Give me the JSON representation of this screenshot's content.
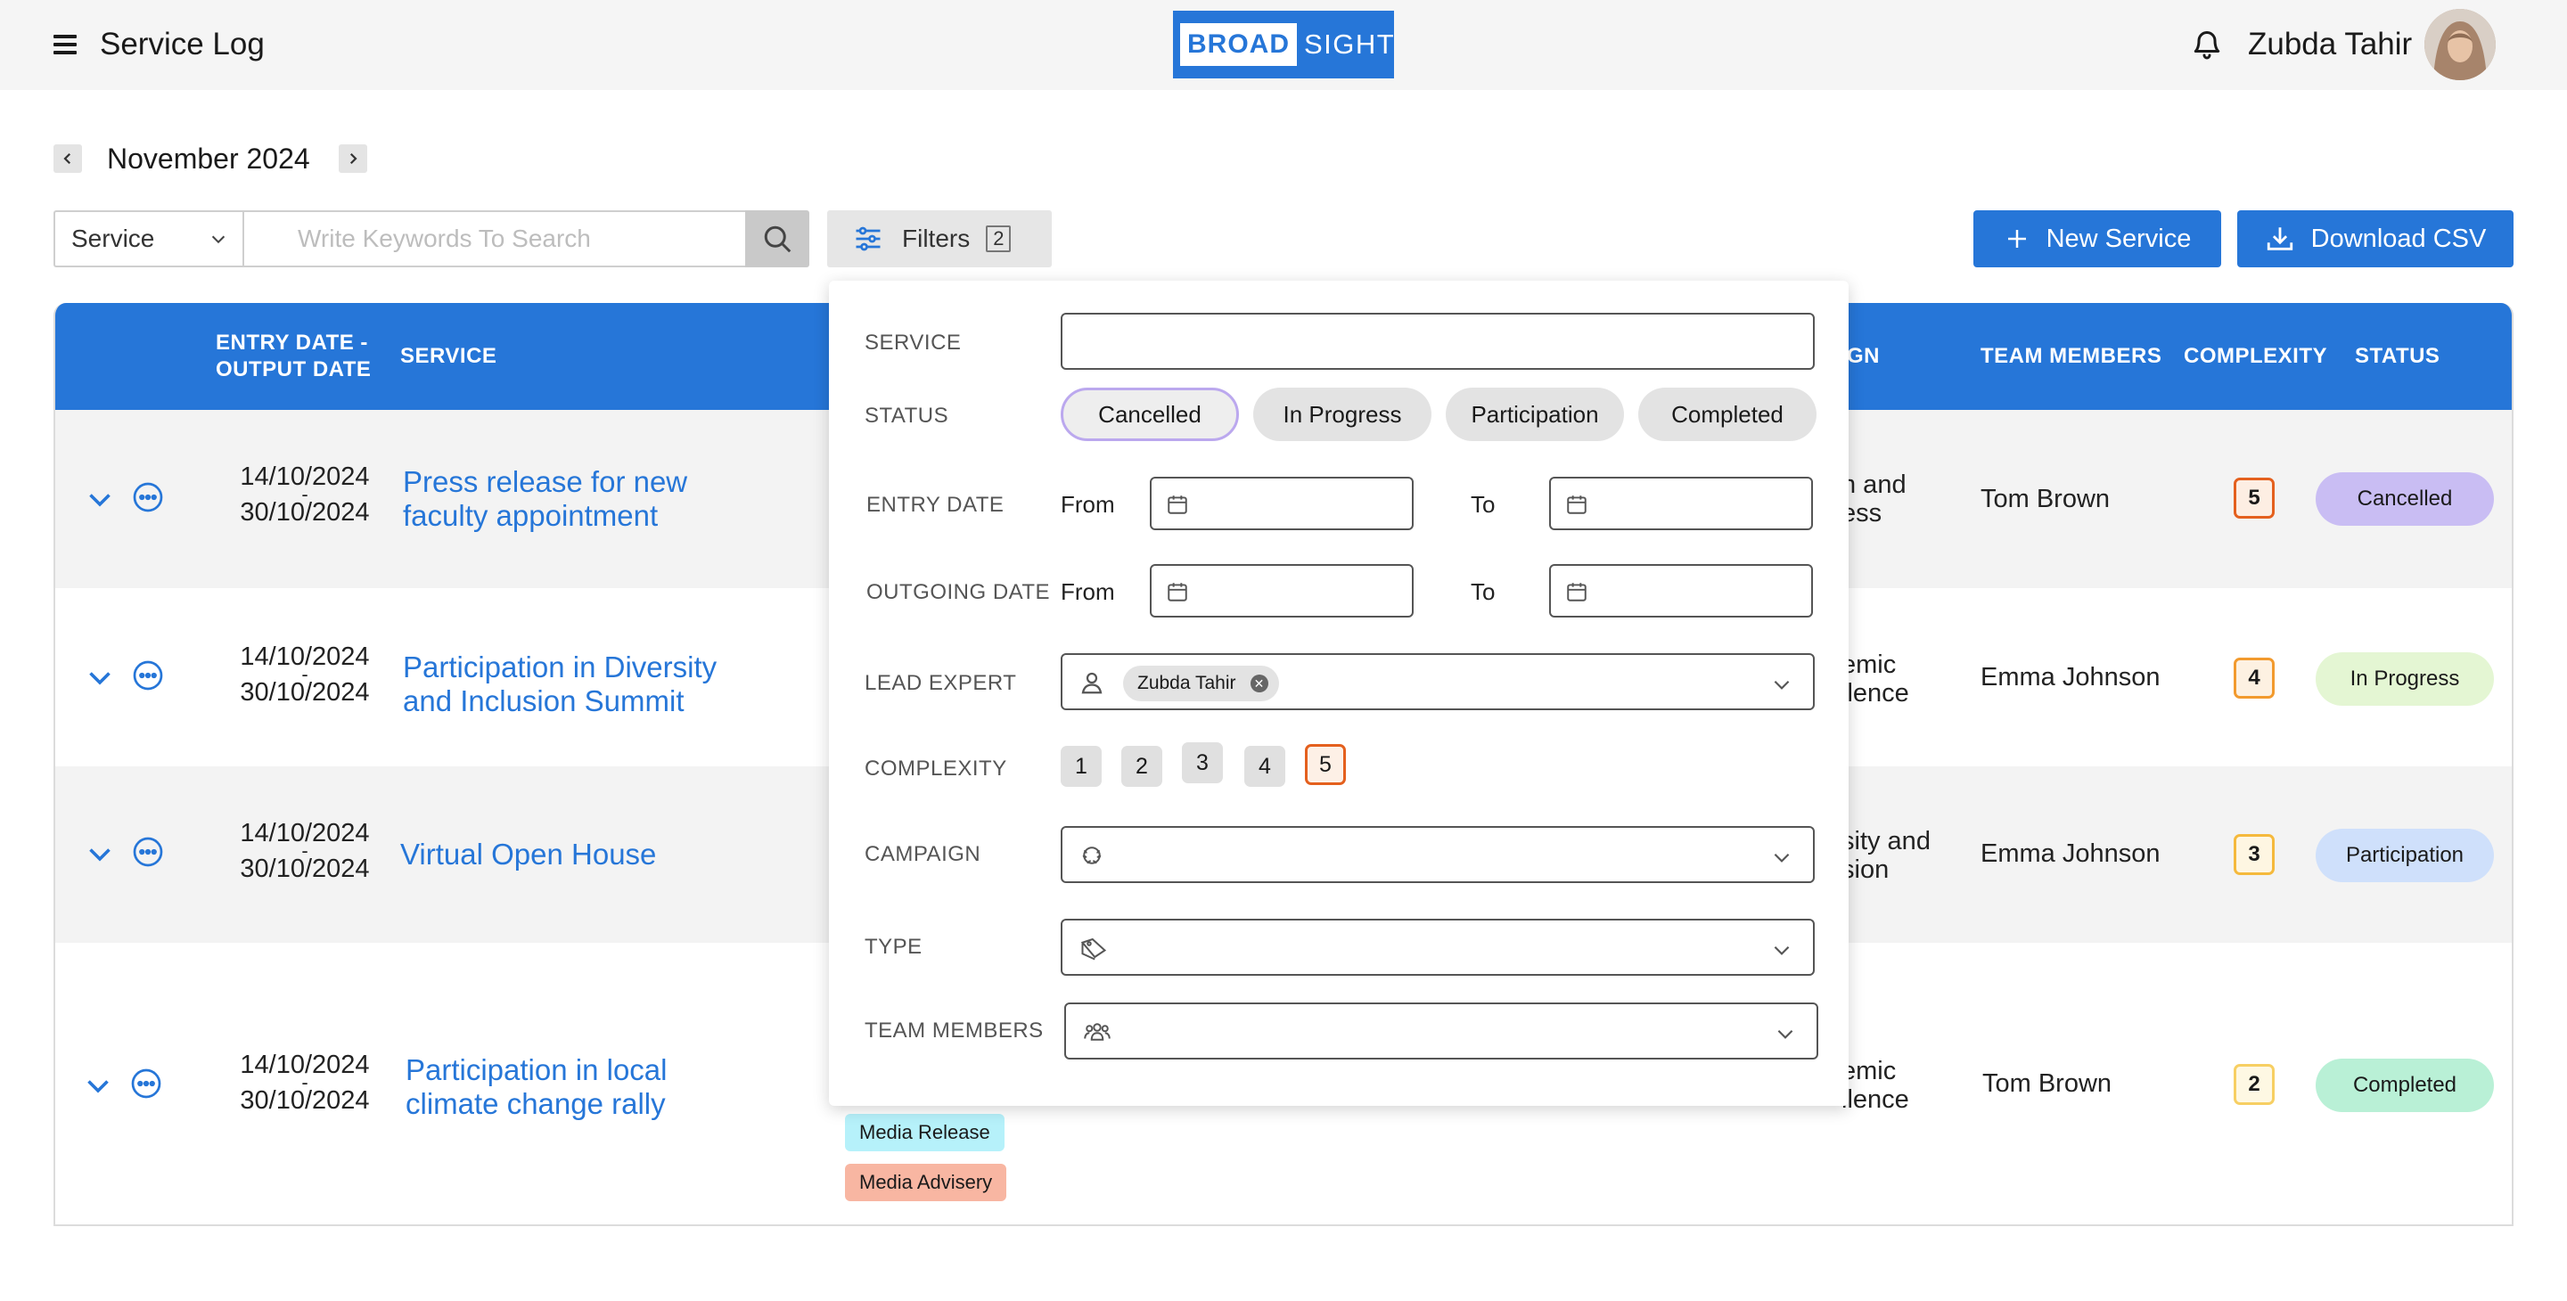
{
  "header": {
    "app_title": "Service Log",
    "logo_part1": "BROAD",
    "logo_part2": "SIGHT",
    "user_name": "Zubda Tahir"
  },
  "period": {
    "month_label": "November 2024"
  },
  "search": {
    "service_select_value": "Service",
    "placeholder": "Write Keywords To Search",
    "filters_label": "Filters",
    "filters_count": "2",
    "new_service_label": "New Service",
    "download_csv_label": "Download CSV"
  },
  "table": {
    "headers": {
      "dates_line1": "ENTRY DATE -",
      "dates_line2": "OUTPUT DATE",
      "service": "SERVICE",
      "campaign_fragment": "GN",
      "team_members": "TEAM MEMBERS",
      "complexity": "COMPLEXITY",
      "status": "STATUS"
    },
    "rows": [
      {
        "entry_date": "14/10/2024",
        "sep": "-",
        "output_date": "30/10/2024",
        "service_line1": "Press release for new",
        "service_line2": "faculty appointment",
        "campaign_line1": "h and",
        "campaign_line2": "ess",
        "team": "Tom Brown",
        "complexity": "5",
        "status": "Cancelled"
      },
      {
        "entry_date": "14/10/2024",
        "sep": "-",
        "output_date": "30/10/2024",
        "service_line1": "Participation in Diversity",
        "service_line2": "and Inclusion Summit",
        "campaign_line1": "emic",
        "campaign_line2": "llence",
        "team": "Emma Johnson",
        "complexity": "4",
        "status": "In Progress"
      },
      {
        "entry_date": "14/10/2024",
        "sep": "-",
        "output_date": "30/10/2024",
        "service_line1": "Virtual Open House",
        "service_line2": "",
        "campaign_line1": "sity and",
        "campaign_line2": "sion",
        "team": "Emma Johnson",
        "complexity": "3",
        "status": "Participation"
      },
      {
        "entry_date": "14/10/2024",
        "sep": "-",
        "output_date": "30/10/2024",
        "service_line1": "Participation in local",
        "service_line2": "climate change rally",
        "campaign_line1": "emic",
        "campaign_line2": "llence",
        "team": "Tom Brown",
        "complexity": "2",
        "status": "Completed",
        "tags": [
          "Media Release",
          "Media Advisery"
        ]
      }
    ]
  },
  "filter_panel": {
    "service_label": "SERVICE",
    "service_value": "",
    "status_label": "STATUS",
    "status_options": [
      "Cancelled",
      "In Progress",
      "Participation",
      "Completed"
    ],
    "status_selected": "Cancelled",
    "entry_date_label": "ENTRY DATE",
    "outgoing_date_label": "OUTGOING DATE",
    "from_label": "From",
    "to_label": "To",
    "lead_expert_label": "LEAD EXPERT",
    "lead_expert_chip": "Zubda Tahir",
    "complexity_label": "COMPLEXITY",
    "complexity_options": [
      "1",
      "2",
      "3",
      "4",
      "5"
    ],
    "complexity_selected": "5",
    "campaign_label": "CAMPAIGN",
    "type_label": "TYPE",
    "team_members_label": "TEAM MEMBERS"
  },
  "colors": {
    "brand_blue": "#2676d8",
    "status_cancelled": "#c9bdf3",
    "status_in_progress": "#e4f6d3",
    "status_participation": "#cfe0fb",
    "status_completed": "#b9f0d6",
    "complexity_5": "#e4601e",
    "complexity_4": "#f29a2e",
    "complexity_3": "#f5b93c",
    "complexity_2": "#f7cf63",
    "tag_media_release": "#b6f1fa",
    "tag_media_advisery": "#f8b6a2"
  }
}
